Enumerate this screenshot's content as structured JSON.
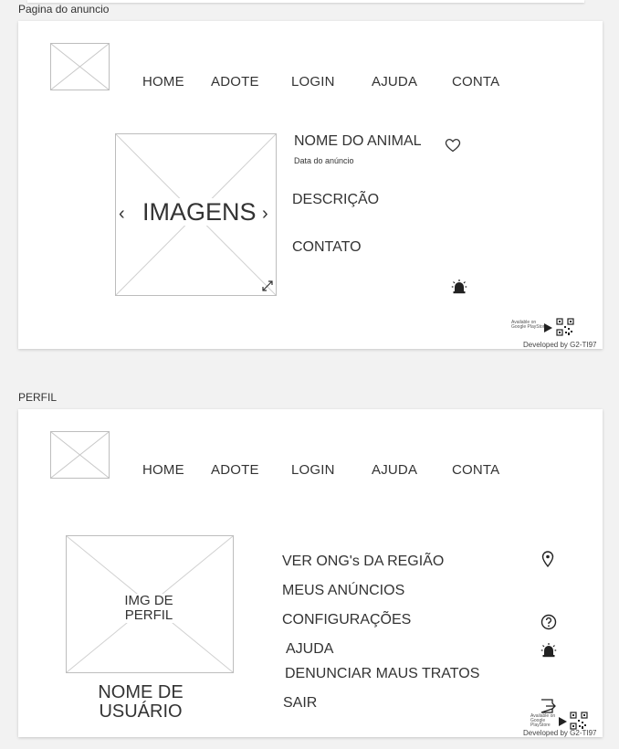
{
  "frames": {
    "anuncio": {
      "label": "Pagina do anuncio"
    },
    "perfil": {
      "label": "PERFIL"
    }
  },
  "nav": [
    "HOME",
    "ADOTE",
    "LOGIN",
    "AJUDA",
    "CONTA"
  ],
  "anuncio": {
    "image_label": "IMAGENS",
    "prev_arrow": "‹",
    "next_arrow": "›",
    "animal_name": "NOME DO ANIMAL",
    "date": "Data do anúncio",
    "description": "DESCRIÇÃO",
    "contact": "CONTATO"
  },
  "perfil": {
    "profile_image_label": [
      "IMG DE",
      "PERFIL"
    ],
    "username": [
      "NOME DE",
      "USUÁRIO"
    ],
    "menu": [
      "VER ONG's DA REGIÃO",
      "MEUS ANÚNCIOS",
      "CONFIGURAÇÕES",
      "AJUDA",
      "DENUNCIAR MAUS TRATOS",
      "SAIR"
    ]
  },
  "footer": {
    "store_badge": [
      "Available on",
      "Google PlayStore"
    ],
    "developed_by": "Developed by G2-TI97"
  },
  "icons": [
    "logo-placeholder",
    "heart-icon",
    "expand-icon",
    "alarm-icon",
    "play-icon",
    "qr-code-icon",
    "location-pin-icon",
    "help-circle-icon",
    "logout-icon"
  ]
}
